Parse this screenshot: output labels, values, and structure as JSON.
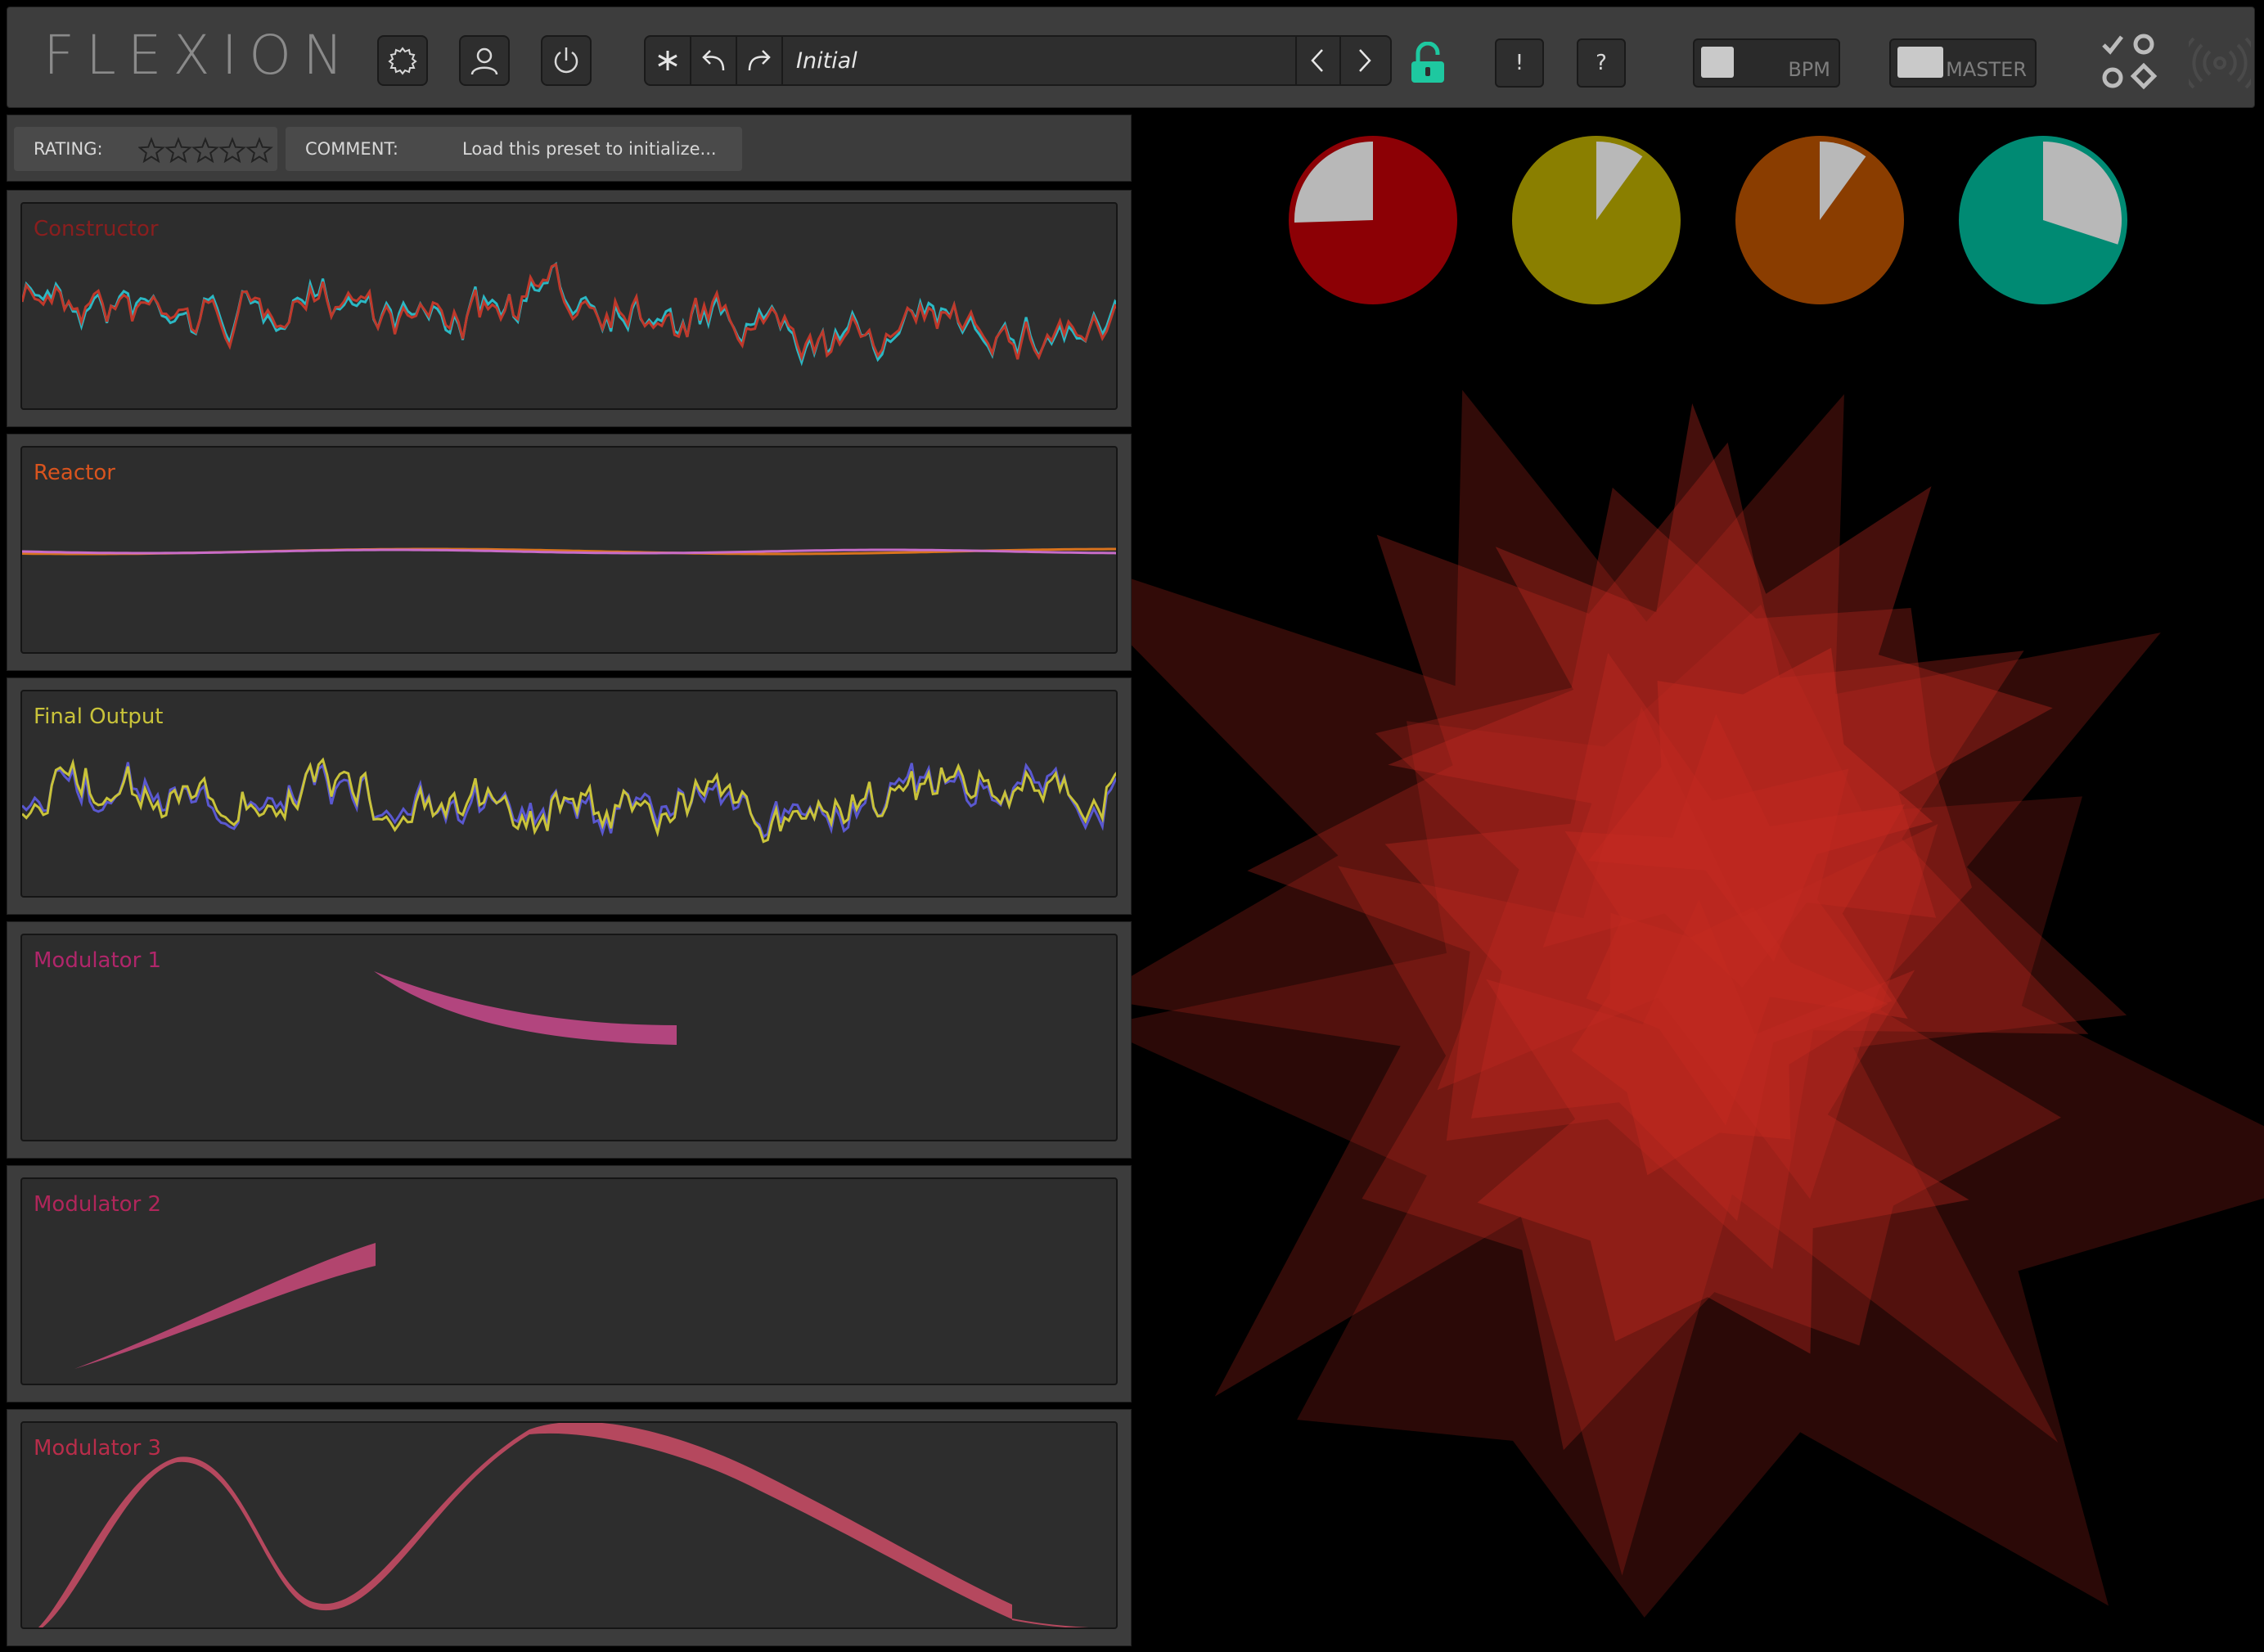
{
  "app": {
    "logo": "FLEXION"
  },
  "toolbar": {
    "settings_icon": "gear-icon",
    "account_icon": "user-icon",
    "power_icon": "power-icon",
    "randomize_icon": "asterisk-icon",
    "undo_icon": "undo-icon",
    "redo_icon": "redo-icon",
    "preset_name": "Initial",
    "prev_icon": "chevron-left-icon",
    "next_icon": "chevron-right-icon",
    "lock_icon": "unlock-icon",
    "alert_label": "!",
    "help_label": "?",
    "bpm_label": "BPM",
    "bpm_level": 0.25,
    "master_label": "MASTER",
    "master_level": 0.35,
    "grid_icon": "shapes-icon",
    "broadcast_icon": "broadcast-icon"
  },
  "rating_bar": {
    "rating_label": "RATING:",
    "stars": 5,
    "stars_filled": 0,
    "comment_label": "COMMENT:",
    "comment_text": "Load this preset to initialize..."
  },
  "panels": [
    {
      "title": "Constructor",
      "color": "#8a1e1e",
      "series_colors": [
        "#2bb8c4",
        "#c0392b"
      ]
    },
    {
      "title": "Reactor",
      "color": "#d9541e",
      "series_colors": [
        "#c86cc8",
        "#d9731e"
      ]
    },
    {
      "title": "Final Output",
      "color": "#c9c33a",
      "series_colors": [
        "#5a58d0",
        "#c9c33a"
      ]
    },
    {
      "title": "Modulator 1",
      "color": "#b0266a",
      "series_colors": [
        "#b2457e"
      ]
    },
    {
      "title": "Modulator 2",
      "color": "#b0265a",
      "series_colors": [
        "#b2456e"
      ]
    },
    {
      "title": "Modulator 3",
      "color": "#b82d4a",
      "series_colors": [
        "#b5485e"
      ]
    }
  ],
  "knobs": [
    {
      "color": "#8c0005",
      "value": 0.75
    },
    {
      "color": "#8a7f00",
      "value": 0.1
    },
    {
      "color": "#8a3d00",
      "value": 0.1
    },
    {
      "color": "#008a73",
      "value": 0.3
    }
  ],
  "colors": {
    "accent_lock": "#1ec8a0",
    "visual_red": "#c62b21"
  }
}
